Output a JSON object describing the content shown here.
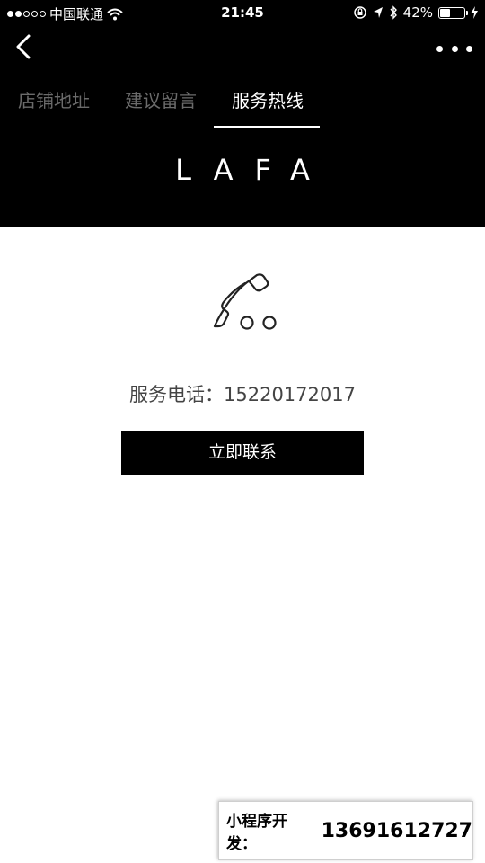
{
  "status_bar": {
    "carrier": "中国联通",
    "time": "21:45",
    "battery_percent": "42%",
    "battery_level": 0.42,
    "signal_bars_filled": 2,
    "signal_bars_total": 5
  },
  "header": {
    "tabs": [
      {
        "label": "店铺地址",
        "active": false
      },
      {
        "label": "建议留言",
        "active": false
      },
      {
        "label": "服务热线",
        "active": true
      }
    ],
    "brand": "LAFA"
  },
  "main": {
    "phone_label": "服务电话：15220172017",
    "contact_button": "立即联系"
  },
  "watermark": {
    "label": "小程序开发：",
    "number": "13691612727"
  },
  "icons": {
    "back": "chevron-left-icon",
    "more": "more-dots-icon",
    "phone": "phone-handset-icon",
    "wifi": "wifi-icon",
    "location": "location-arrow-icon",
    "bluetooth": "bluetooth-icon",
    "lock_rotation": "rotation-lock-icon",
    "charging": "charging-bolt-icon"
  },
  "colors": {
    "header_bg": "#000000",
    "tab_inactive": "#6b6b6b",
    "tab_active": "#ffffff",
    "button_bg": "#000000",
    "body_bg": "#ffffff"
  }
}
